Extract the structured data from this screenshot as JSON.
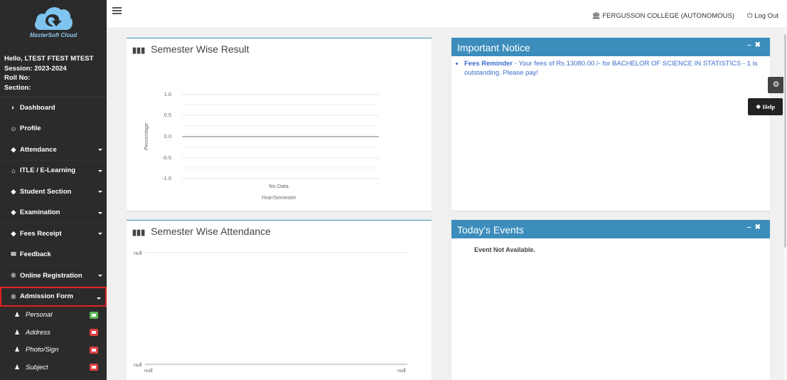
{
  "sidebar": {
    "logo_text": "MasterSoft Cloud",
    "user": {
      "greeting": "Hello, LTEST FTEST MTEST",
      "session": "Session: 2023-2024",
      "roll_no": "Roll No:",
      "section": "Section:"
    },
    "menu": [
      {
        "label": "Dashboard",
        "icon": "dashboard-icon",
        "glyph": "◐"
      },
      {
        "label": "Profile",
        "icon": "user-circle-icon",
        "glyph": "☺"
      },
      {
        "label": "Attendance",
        "icon": "tag-icon",
        "glyph": "◆"
      },
      {
        "label": "ITLE / E-Learning",
        "icon": "graduation-cap-icon",
        "glyph": "⌂"
      },
      {
        "label": "Student Section",
        "icon": "tag-icon",
        "glyph": "◆"
      },
      {
        "label": "Examination",
        "icon": "tag-icon",
        "glyph": "◆"
      },
      {
        "label": "Fees Receipt",
        "icon": "tag-icon",
        "glyph": "◆"
      },
      {
        "label": "Feedback",
        "icon": "comments-icon",
        "glyph": "✉"
      },
      {
        "label": "Online Registration",
        "icon": "registered-icon",
        "glyph": "®"
      },
      {
        "label": "Admission Form",
        "icon": "registered-icon",
        "glyph": "®"
      }
    ],
    "submenu": [
      {
        "label": "Personal",
        "icon": "user-icon",
        "badge_color": "#5cb85c"
      },
      {
        "label": "Address",
        "icon": "user-icon",
        "badge_color": "#e04040"
      },
      {
        "label": "Photo/Sign",
        "icon": "user-icon",
        "badge_color": "#e04040"
      },
      {
        "label": "Subject",
        "icon": "user-icon",
        "badge_color": "#e04040"
      }
    ]
  },
  "topbar": {
    "college": "FERGUSSON COLLEGE (AUTONOMOUS)",
    "logout": "Log Out"
  },
  "panels": {
    "result": {
      "title": "Semester Wise Result",
      "chart_data": {
        "type": "line",
        "title": "Semester Wise Result",
        "xlabel": "Year/Semester",
        "ylabel": "Percentage",
        "yticks": [
          "1.0",
          "0.5",
          "0.0",
          "-0.5",
          "-1.0"
        ],
        "ylim": [
          -1.0,
          1.0
        ],
        "no_data_label": "No Data",
        "series": []
      }
    },
    "attendance": {
      "title": "Semester Wise Attendance",
      "chart_data": {
        "type": "line",
        "title": "Semester Wise Attendance",
        "ytick_top": "null",
        "ytick_bottom": "null",
        "xtick_left": "null",
        "xtick_right": "null",
        "series": []
      }
    },
    "notice": {
      "title": "Important Notice",
      "item_bold": "Fees Reminder",
      "item_text": " - Your fees of Rs.13080.00 /- for BACHELOR OF SCIENCE IN STATISTICS - 1 is outstanding. Please pay!"
    },
    "events": {
      "title": "Today's Events",
      "empty_text": "Event Not Available."
    }
  },
  "help": {
    "label": "Help"
  }
}
